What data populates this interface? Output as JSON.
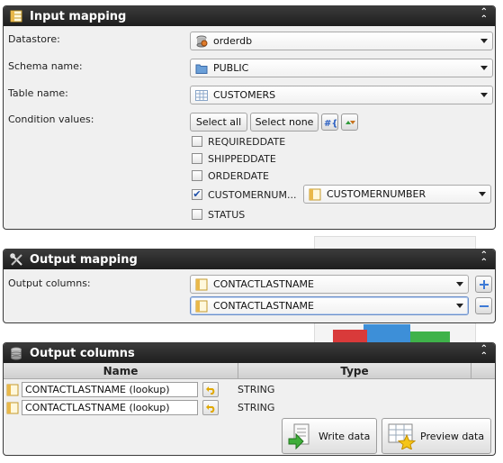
{
  "input_mapping": {
    "title": "Input mapping",
    "datastore_label": "Datastore:",
    "datastore_value": "orderdb",
    "schema_label": "Schema name:",
    "schema_value": "PUBLIC",
    "table_label": "Table name:",
    "table_value": "CUSTOMERS",
    "condition_label": "Condition values:",
    "select_all_label": "Select all",
    "select_none_label": "Select none",
    "conditions": [
      {
        "label": "REQUIREDDATE",
        "checked": false
      },
      {
        "label": "SHIPPEDDATE",
        "checked": false
      },
      {
        "label": "ORDERDATE",
        "checked": false
      },
      {
        "label": "CUSTOMERNUM...",
        "checked": true,
        "mapped_value": "CUSTOMERNUMBER"
      },
      {
        "label": "STATUS",
        "checked": false
      }
    ]
  },
  "output_mapping": {
    "title": "Output mapping",
    "columns_label": "Output columns:",
    "columns": [
      "CONTACTLASTNAME",
      "CONTACTLASTNAME"
    ]
  },
  "output_columns": {
    "title": "Output columns",
    "headers": {
      "name": "Name",
      "type": "Type"
    },
    "rows": [
      {
        "name": "CONTACTLASTNAME (lookup)",
        "type": "STRING"
      },
      {
        "name": "CONTACTLASTNAME (lookup)",
        "type": "STRING"
      }
    ],
    "write_data_label": "Write data",
    "preview_data_label": "Preview data"
  },
  "colors": {
    "header_bg": "#262626",
    "panel_bg": "#f0f0f0",
    "accent_blue": "#3d7ad6"
  }
}
